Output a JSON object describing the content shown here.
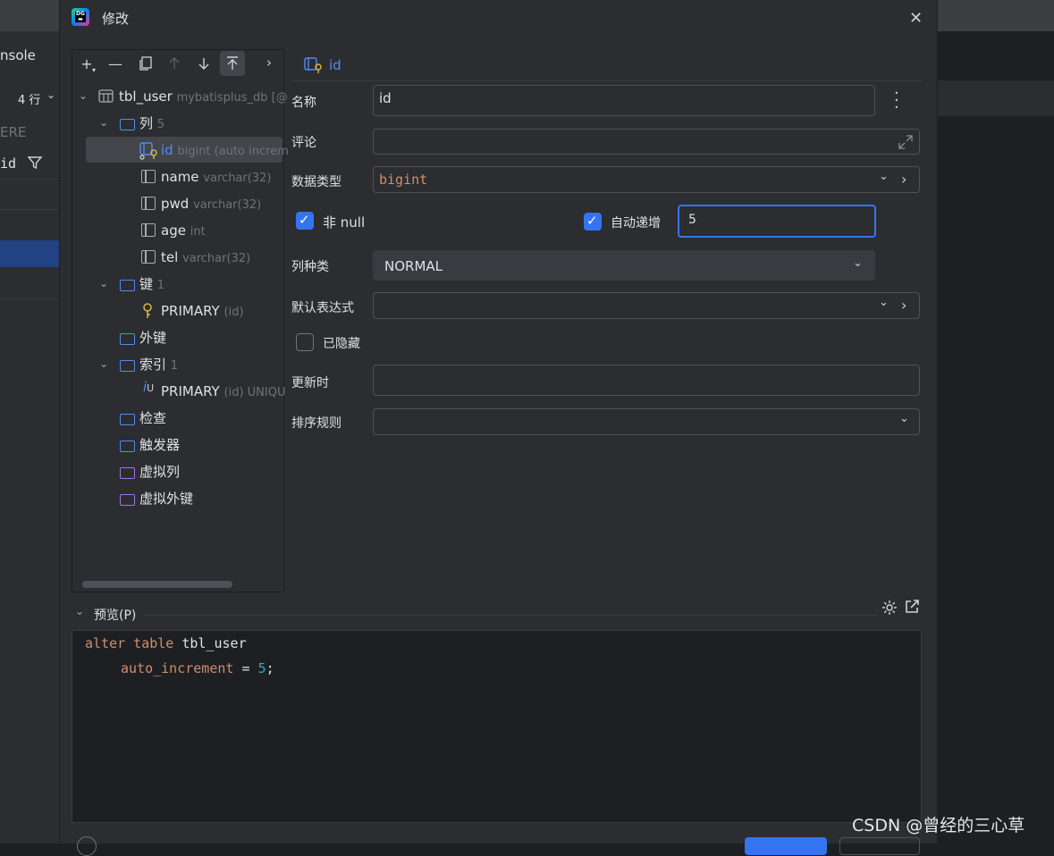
{
  "background": {
    "left_texts": [
      "nsole",
      "4 行",
      "ERE",
      "id"
    ]
  },
  "dialog": {
    "title": "修改",
    "close_icon": "close-icon"
  },
  "tree": {
    "table": {
      "name": "tbl_user",
      "meta": "mybatisplus_db [@"
    },
    "columns_folder": {
      "label": "列",
      "count": "5"
    },
    "columns": [
      {
        "name": "id",
        "type": "bigint (auto increm"
      },
      {
        "name": "name",
        "type": "varchar(32)"
      },
      {
        "name": "pwd",
        "type": "varchar(32)"
      },
      {
        "name": "age",
        "type": "int"
      },
      {
        "name": "tel",
        "type": "varchar(32)"
      }
    ],
    "keys_folder": {
      "label": "键",
      "count": "1"
    },
    "key_item": {
      "name": "PRIMARY",
      "meta": "(id)"
    },
    "fk_folder": {
      "label": "外键"
    },
    "index_folder": {
      "label": "索引",
      "count": "1"
    },
    "index_item": {
      "name": "PRIMARY",
      "meta": "(id) UNIQU"
    },
    "checks_folder": {
      "label": "检查"
    },
    "triggers_folder": {
      "label": "触发器"
    },
    "virtual_cols_folder": {
      "label": "虚拟列"
    },
    "virtual_fk_folder": {
      "label": "虚拟外键"
    }
  },
  "form": {
    "tab_label": "id",
    "name_label": "名称",
    "name_value": "id",
    "comment_label": "评论",
    "comment_value": "",
    "datatype_label": "数据类型",
    "datatype_value": "bigint",
    "notnull_label": "非 null",
    "notnull_checked": true,
    "autoinc_label": "自动递增",
    "autoinc_checked": true,
    "autoinc_value": "5",
    "colkind_label": "列种类",
    "colkind_value": "NORMAL",
    "default_label": "默认表达式",
    "default_value": "",
    "hidden_label": "已隐藏",
    "hidden_checked": false,
    "onupdate_label": "更新时",
    "onupdate_value": "",
    "collation_label": "排序规则",
    "collation_value": ""
  },
  "preview": {
    "label": "预览(P)",
    "code_line1_kw": "alter table",
    "code_line1_rest": " tbl_user",
    "code_line2_kw": "auto_increment",
    "code_line2_eq": " = ",
    "code_line2_num": "5",
    "code_line2_end": ";"
  },
  "watermark": "CSDN @曾经的三心草",
  "colors": {
    "accent": "#3574f0",
    "keyword": "#cf8e6d",
    "number": "#2aacb8",
    "folder": "#548af7"
  }
}
